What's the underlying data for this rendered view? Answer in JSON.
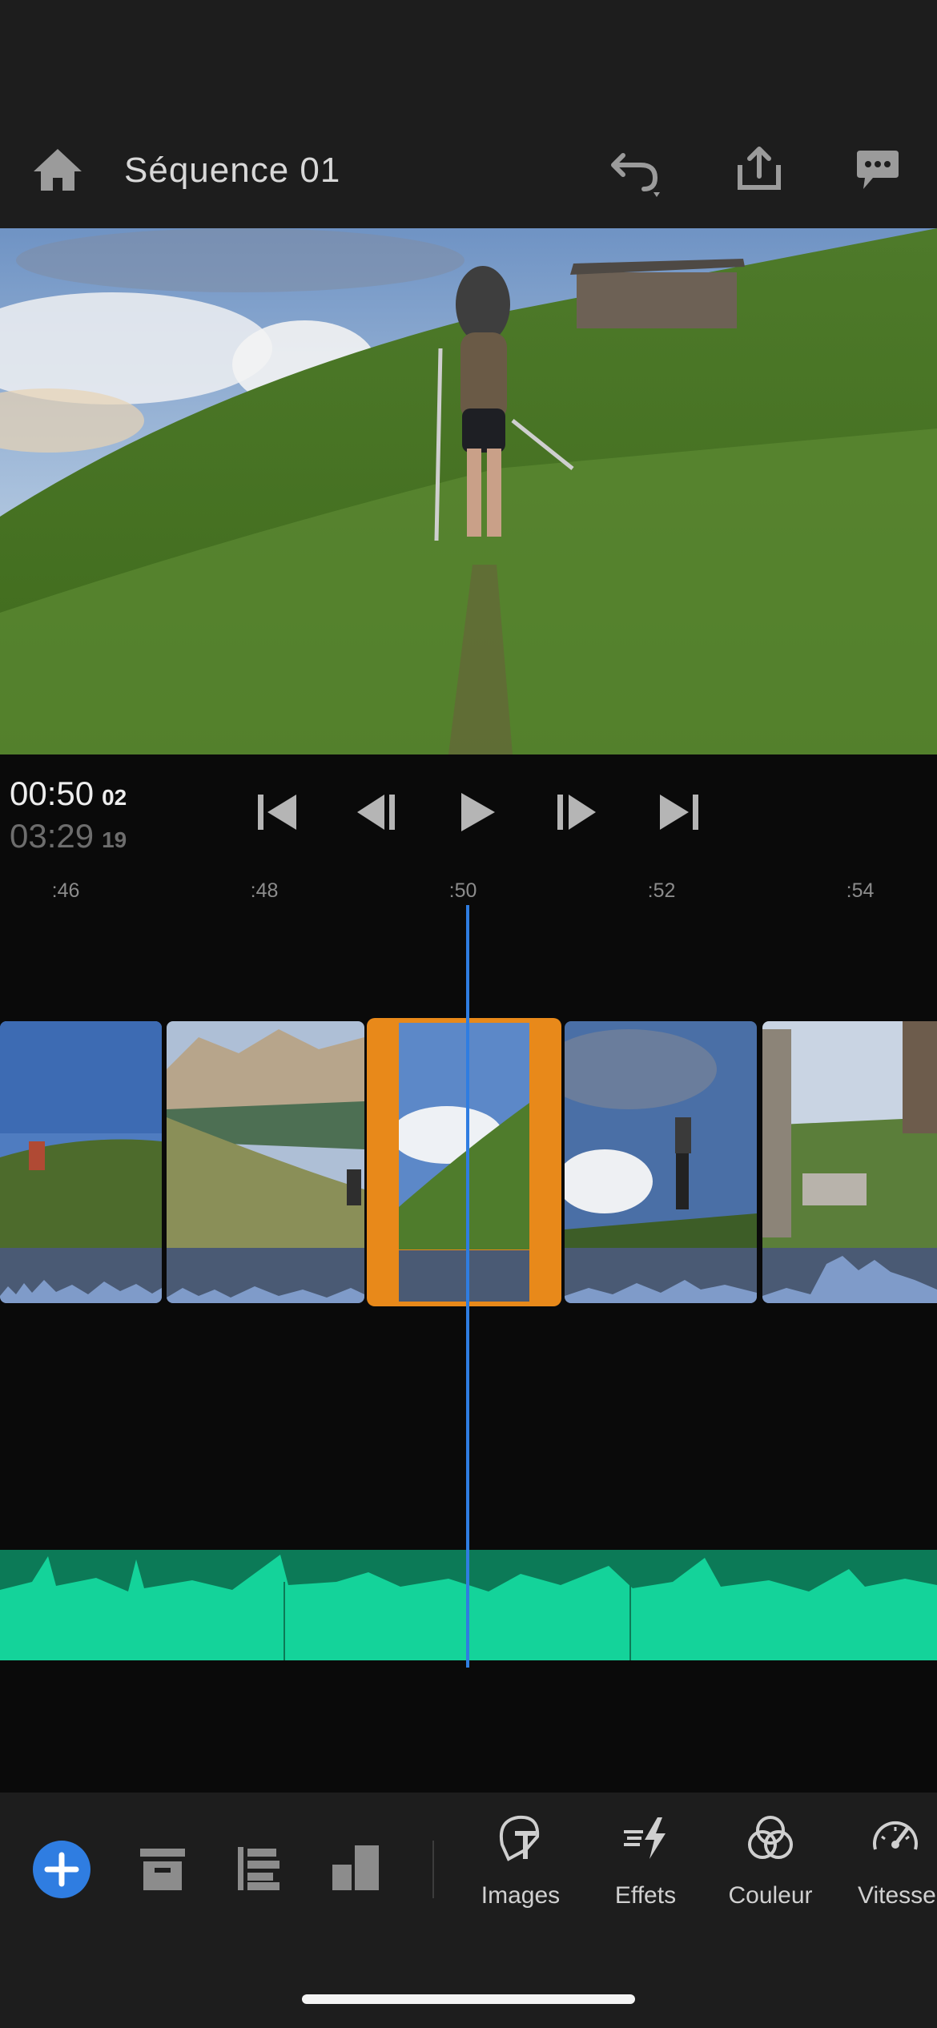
{
  "header": {
    "title": "Séquence 01",
    "icons": [
      "home-icon",
      "undo-icon",
      "share-icon",
      "feedback-icon"
    ]
  },
  "transport": {
    "current_time": "00:50",
    "current_frame": "02",
    "duration_time": "03:29",
    "duration_frame": "19",
    "icons": [
      "skip-to-start-icon",
      "step-back-icon",
      "play-icon",
      "step-forward-icon",
      "skip-to-end-icon"
    ]
  },
  "ruler": {
    "ticks": [
      ":46",
      ":48",
      ":50",
      ":52",
      ":54"
    ]
  },
  "timeline": {
    "clips": [
      "clip-hiker-on-ridge",
      "clip-mountain-meadow",
      "clip-selected-sky-hill",
      "clip-hiker-cloudy-sky",
      "clip-wooden-hut"
    ],
    "selected_clip_index": 2
  },
  "toolbar": {
    "left_icons": [
      "add-icon",
      "archive-icon",
      "align-left-icon",
      "layers-icon"
    ],
    "tools": [
      {
        "label": "Images",
        "icon": "titles-icon"
      },
      {
        "label": "Effets",
        "icon": "effects-icon"
      },
      {
        "label": "Couleur",
        "icon": "color-icon"
      },
      {
        "label": "Vitesse",
        "icon": "speed-icon"
      }
    ]
  },
  "colors": {
    "accent_blue": "#2f7de1",
    "selection_orange": "#e8891a",
    "audio_green": "#14d39a",
    "audio_green_dark": "#0c7a57"
  }
}
